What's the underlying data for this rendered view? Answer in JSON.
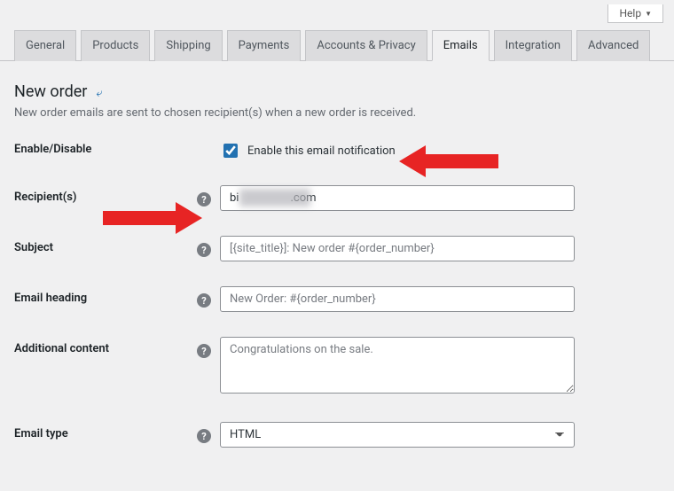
{
  "help_button": "Help",
  "tabs": {
    "general": "General",
    "products": "Products",
    "shipping": "Shipping",
    "payments": "Payments",
    "accounts": "Accounts & Privacy",
    "emails": "Emails",
    "integration": "Integration",
    "advanced": "Advanced"
  },
  "section": {
    "title": "New order",
    "back_icon": "⤶",
    "description": "New order emails are sent to chosen recipient(s) when a new order is received."
  },
  "fields": {
    "enable": {
      "label": "Enable/Disable",
      "checkbox_label": "Enable this email notification",
      "checked": true
    },
    "recipients": {
      "label": "Recipient(s)",
      "value_prefix": "bi",
      "value_suffix": ".com"
    },
    "subject": {
      "label": "Subject",
      "placeholder": "[{site_title}]: New order #{order_number}",
      "value": ""
    },
    "heading": {
      "label": "Email heading",
      "placeholder": "New Order: #{order_number}",
      "value": ""
    },
    "additional": {
      "label": "Additional content",
      "placeholder": "Congratulations on the sale.",
      "value": ""
    },
    "type": {
      "label": "Email type",
      "value": "HTML"
    }
  }
}
